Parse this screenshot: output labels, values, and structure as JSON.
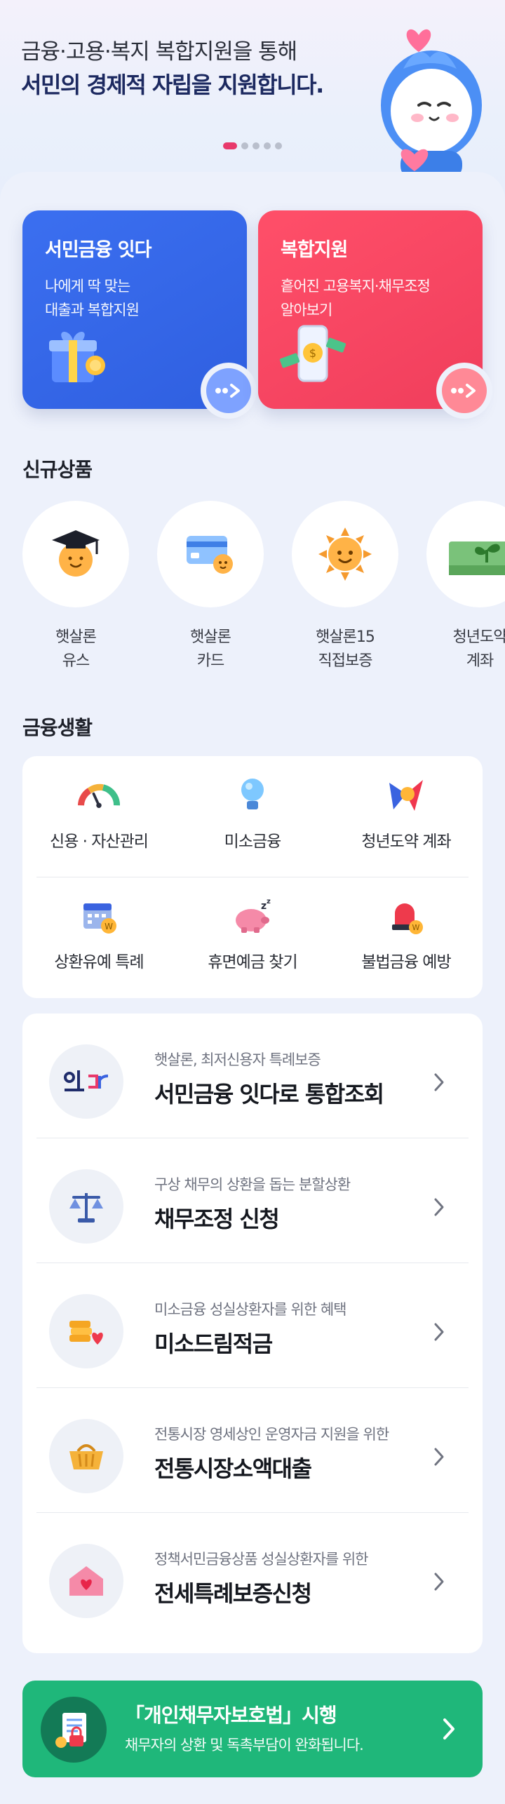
{
  "hero": {
    "line1": "금융·고용·복지 복합지원을 통해",
    "line2": "서민의 경제적 자립을 지원합니다.",
    "slides_total": 5,
    "slide_active": 1
  },
  "promos": [
    {
      "title": "서민금융 잇다",
      "desc": "나에게 딱 맞는\n대출과 복합지원",
      "color": "#3467ec",
      "icon": "gift-box-icon"
    },
    {
      "title": "복합지원",
      "desc": "흩어진 고용복지·채무조정\n알아보기",
      "color": "#f5435f",
      "icon": "phone-money-icon"
    }
  ],
  "new_products": {
    "title": "신규상품",
    "items": [
      {
        "label": "햇살론\n유스",
        "icon": "graduation-sun-icon"
      },
      {
        "label": "햇살론\n카드",
        "icon": "card-sun-icon"
      },
      {
        "label": "햇살론15\n직접보증",
        "icon": "sun-icon"
      },
      {
        "label": "청년도약\n계좌",
        "icon": "sprout-icon"
      }
    ]
  },
  "finance_life": {
    "title": "금융생활",
    "items": [
      {
        "label": "신용 · 자산관리",
        "icon": "gauge-icon"
      },
      {
        "label": "미소금융",
        "icon": "lightbulb-icon"
      },
      {
        "label": "청년도약 계좌",
        "icon": "star-jump-icon"
      },
      {
        "label": "상환유예 특례",
        "icon": "calendar-coin-icon"
      },
      {
        "label": "휴면예금 찾기",
        "icon": "sleeping-piggy-icon"
      },
      {
        "label": "불법금융 예방",
        "icon": "siren-icon"
      }
    ]
  },
  "services": [
    {
      "sub": "햇살론, 최저신용자 특례보증",
      "main": "서민금융 잇다로 통합조회",
      "icon": "itda-logo-icon"
    },
    {
      "sub": "구상 채무의 상환을 돕는 분할상환",
      "main": "채무조정 신청",
      "icon": "scale-icon"
    },
    {
      "sub": "미소금융 성실상환자를 위한 혜택",
      "main": "미소드림적금",
      "icon": "coin-heart-icon"
    },
    {
      "sub": "전통시장 영세상인 운영자금 지원을 위한",
      "main": "전통시장소액대출",
      "icon": "basket-icon"
    },
    {
      "sub": "정책서민금융상품 성실상환자를 위한",
      "main": "전세특례보증신청",
      "icon": "house-heart-icon"
    }
  ],
  "banner": {
    "title": "「개인채무자보호법」시행",
    "desc": "채무자의 상환 및 독촉부담이 완화됩니다.",
    "color": "#1fb77a",
    "icon": "document-lock-icon"
  }
}
